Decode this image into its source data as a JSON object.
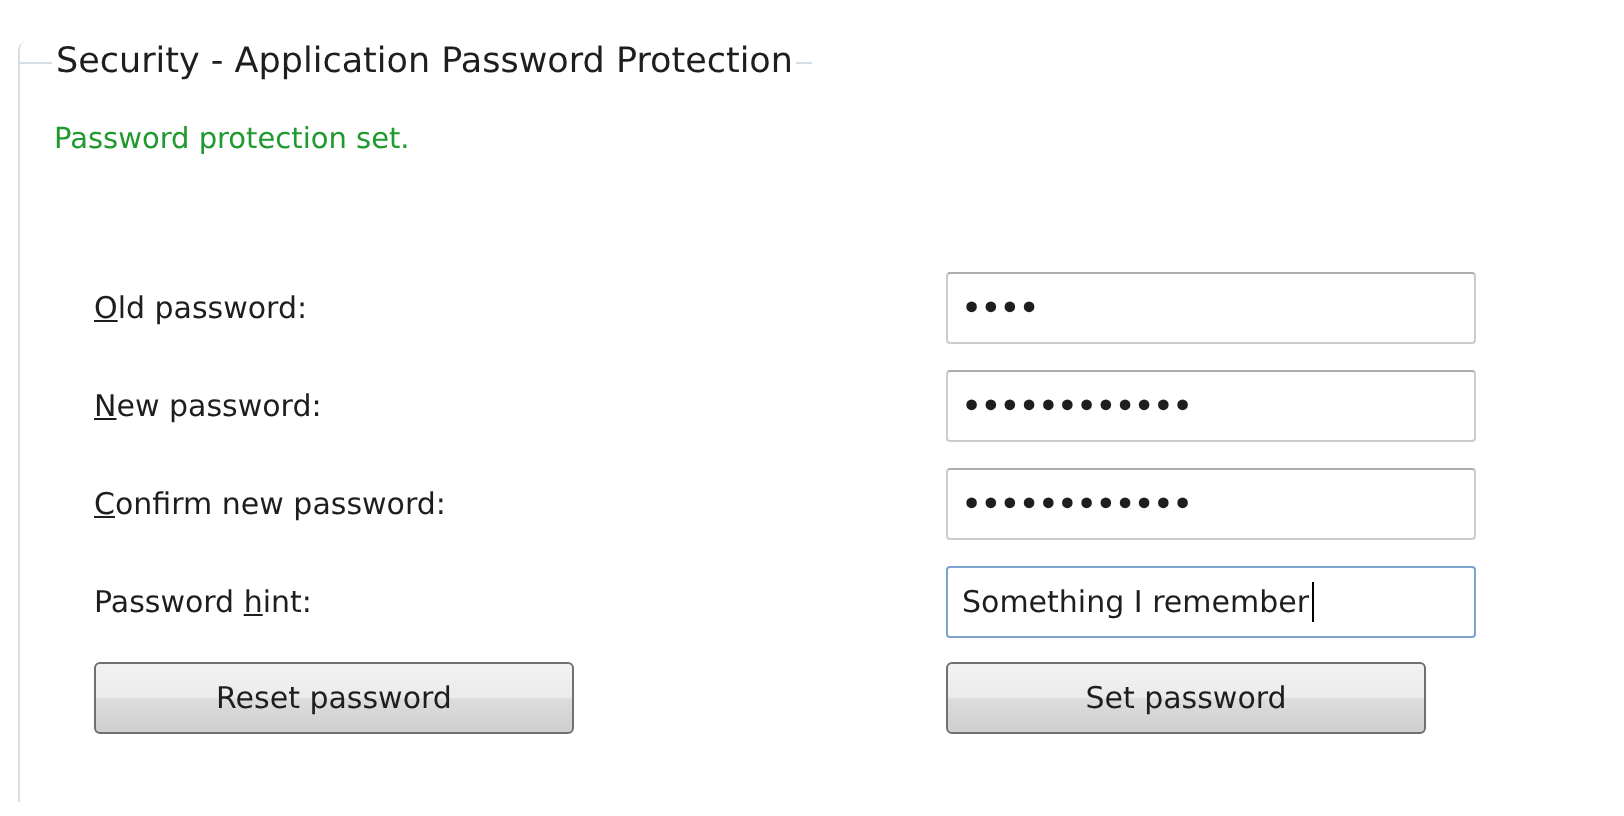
{
  "group": {
    "title": "Security - Application Password Protection"
  },
  "status": {
    "text": "Password protection set.",
    "kind": "success"
  },
  "fields": [
    {
      "access_key": "O",
      "label_end": "ld password:",
      "value": "••••",
      "focused": false
    },
    {
      "access_key": "N",
      "label_end": "ew password:",
      "value": "••••••••••••",
      "focused": false
    },
    {
      "access_key": "C",
      "label_end": "onfirm new password:",
      "value": "••••••••••••",
      "focused": false
    },
    {
      "label_start": "Password ",
      "access_key": "h",
      "label_end": "int:",
      "value": "Something I remember",
      "focused": true
    }
  ],
  "buttons": [
    "Reset password",
    "Set password"
  ]
}
